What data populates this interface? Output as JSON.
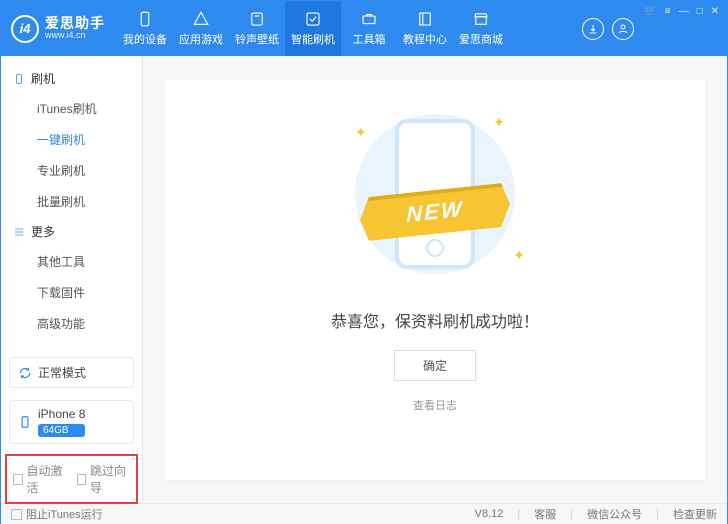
{
  "logo": {
    "icon_text": "i4",
    "title": "爱思助手",
    "sub": "www.i4.cn"
  },
  "nav": [
    {
      "label": "我的设备",
      "icon": "phone"
    },
    {
      "label": "应用游戏",
      "icon": "apps"
    },
    {
      "label": "铃声壁纸",
      "icon": "music"
    },
    {
      "label": "智能刷机",
      "icon": "flash",
      "active": true
    },
    {
      "label": "工具箱",
      "icon": "toolbox"
    },
    {
      "label": "教程中心",
      "icon": "book"
    },
    {
      "label": "爱思商城",
      "icon": "store"
    }
  ],
  "sidebar": {
    "group1": {
      "title": "刷机",
      "items": [
        "iTunes刷机",
        "一键刷机",
        "专业刷机",
        "批量刷机"
      ],
      "active_index": 1
    },
    "group2": {
      "title": "更多",
      "items": [
        "其他工具",
        "下载固件",
        "高级功能"
      ]
    }
  },
  "mode": {
    "label": "正常模式"
  },
  "device": {
    "name": "iPhone 8",
    "storage": "64GB"
  },
  "bottom_opts": {
    "a": "自动激活",
    "b": "跳过向导"
  },
  "main": {
    "ribbon": "NEW",
    "success": "恭喜您，保资料刷机成功啦！",
    "ok": "确定",
    "log": "查看日志"
  },
  "footer": {
    "block_itunes": "阻止iTunes运行",
    "version": "V8.12",
    "links": [
      "客服",
      "微信公众号",
      "检查更新"
    ]
  },
  "win": {
    "cart": "🛒",
    "menu": "≡",
    "min": "—",
    "max": "□",
    "close": "✕"
  }
}
